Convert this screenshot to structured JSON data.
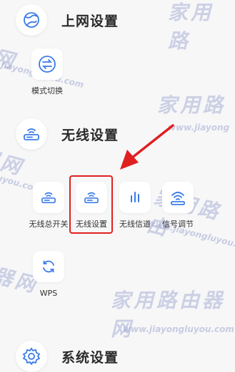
{
  "sections": {
    "network": {
      "title": "上网设置",
      "icon": "globe-icon"
    },
    "wireless": {
      "title": "无线设置",
      "icon": "router-icon"
    },
    "system": {
      "title": "系统设置",
      "icon": "gear-icon"
    }
  },
  "network_items": [
    {
      "label": "模式切换",
      "icon": "mode-switch-icon"
    }
  ],
  "wireless_items": [
    {
      "label": "无线总开关",
      "icon": "router-icon"
    },
    {
      "label": "无线设置",
      "icon": "router-icon"
    },
    {
      "label": "无线信道",
      "icon": "channel-bars-icon"
    },
    {
      "label": "信号调节",
      "icon": "signal-tower-icon"
    },
    {
      "label": "WPS",
      "icon": "refresh-icon"
    }
  ],
  "watermarks": {
    "cn": "家用路由器网",
    "en": "www.jiayongluyou.com"
  },
  "colors": {
    "accent": "#3b7be8",
    "highlight": "#e02020"
  }
}
